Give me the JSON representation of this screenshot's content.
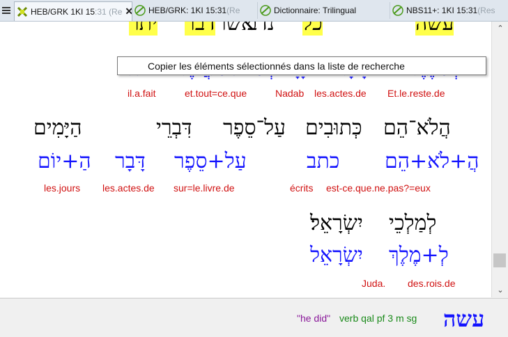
{
  "tabs": [
    {
      "label": "HEB/GRK 1KI 15",
      "faded": ":31 (Re",
      "icon": "hebrew-grid-icon",
      "active": true,
      "closable": true
    },
    {
      "label": "HEB/GRK: 1KI 15:31",
      "faded": " (Re",
      "icon": "green-check-icon",
      "active": false
    },
    {
      "label": "Dictionnaire: Trilingual",
      "faded": "",
      "icon": "green-check-icon",
      "active": false
    },
    {
      "label": "NBS11+: 1KI 15:31",
      "faded": " (Res",
      "icon": "green-check-icon",
      "active": false
    }
  ],
  "tooltip": {
    "text": "Copier les éléments sélectionnés dans la liste de recherche"
  },
  "verse": {
    "partial_top": [
      "עשה",
      "יתר",
      "דבר",
      "נדב",
      "כל",
      "אשר"
    ],
    "row1": {
      "lemmas": [
        "וְ+יֶתֶר",
        "דָּבָר",
        "נָדָב",
        "וְ+כֹּל+אֲשֶׁר",
        "עשׂה"
      ],
      "glosses": [
        "Et.le.reste.de",
        "les.actes.de",
        "Nadab",
        "et.tout=ce.que",
        "il.a.fait"
      ]
    },
    "row2": {
      "words": [
        "הֲלֹא־הֵם",
        "כְּתוּבִים",
        "עַל־סֵפֶר",
        "דִּבְרֵי",
        "הַיָּמִים"
      ],
      "lemmas": [
        "הֲ+לֹא+הֵם",
        "כתב",
        "עַל+סֵפֶר",
        "דָּבָר",
        "הַ+יוֹם"
      ],
      "glosses": [
        "écrits",
        "est-ce.que.ne.pas?=eux",
        "sur=le.livre.de",
        "les.actes.de",
        "les.jours"
      ]
    },
    "row3": {
      "words": [
        "לְמַלְכֵי",
        "יִשְׂרָאֵל׃"
      ],
      "lemmas": [
        "לְ+מֶלֶךְ",
        "יִשְׂרָאֵל"
      ],
      "glosses": [
        "des.rois.de",
        "Juda."
      ]
    }
  },
  "status": {
    "gloss": "\"he did\"",
    "morph": "verb qal pf 3 m sg",
    "word": "עשה",
    "gloss_color": "#8a1a9a",
    "morph_color": "#1a8a1a"
  },
  "colors": {
    "hebrew_text": "#000000",
    "lemma": "#1414ff",
    "gloss": "#d01010",
    "highlight": "#ffff4a"
  }
}
